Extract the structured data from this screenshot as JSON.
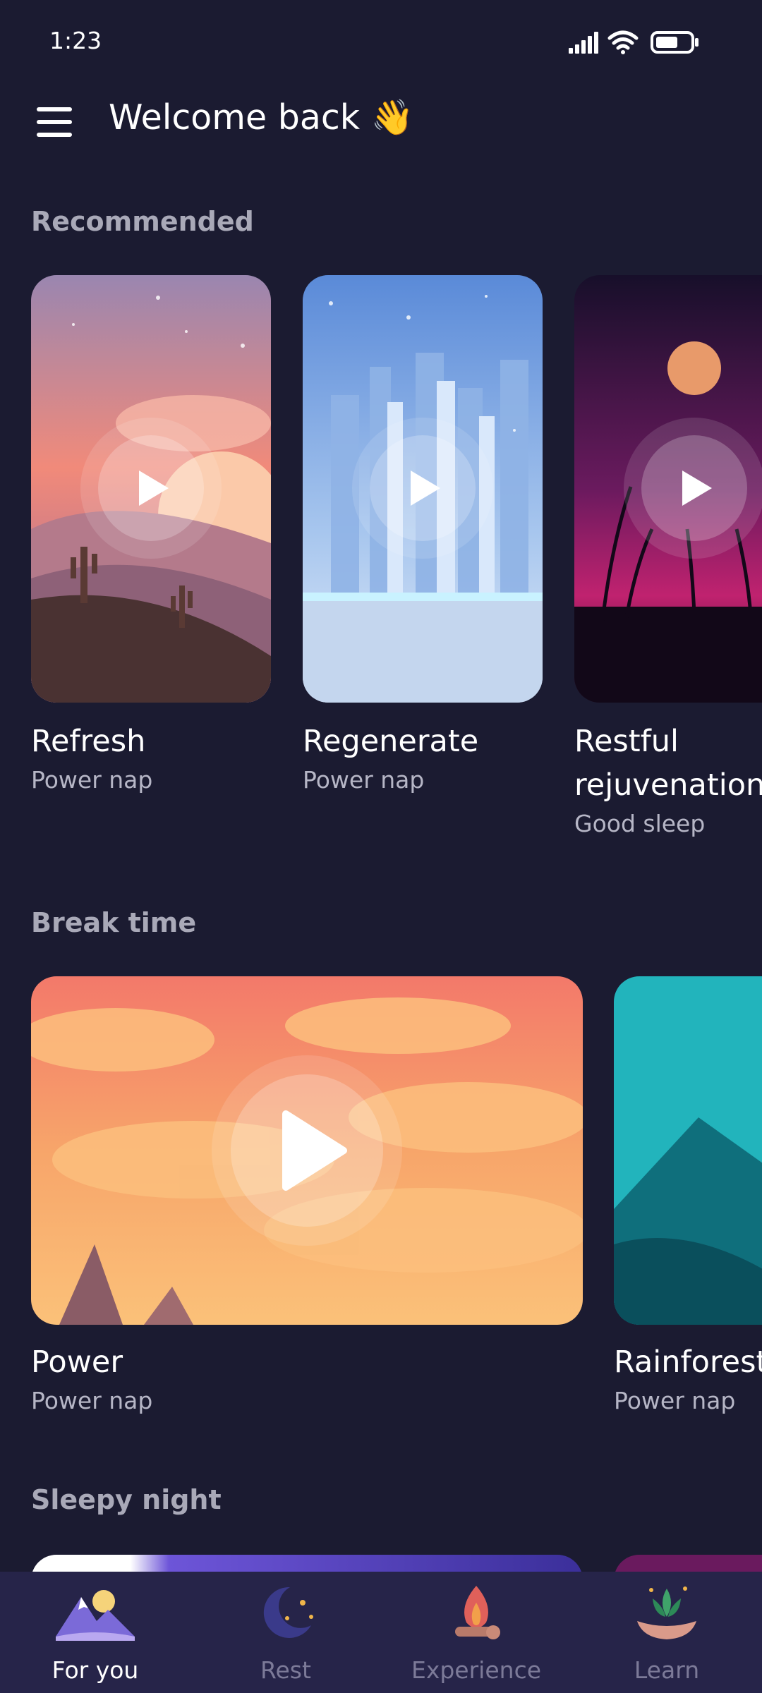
{
  "status_bar": {
    "time": "1:23"
  },
  "header": {
    "title": "Welcome back 👋"
  },
  "sections": {
    "recommended": {
      "title": "Recommended",
      "cards": [
        {
          "title": "Refresh",
          "subtitle": "Power nap"
        },
        {
          "title": "Regenerate",
          "subtitle": "Power nap"
        },
        {
          "title": "Restful rejuvenation",
          "subtitle": "Good sleep"
        }
      ]
    },
    "break_time": {
      "title": "Break time",
      "cards": [
        {
          "title": "Power",
          "subtitle": "Power nap"
        },
        {
          "title": "Rainforest",
          "subtitle": "Power nap"
        }
      ]
    },
    "sleepy_night": {
      "title": "Sleepy night"
    }
  },
  "nav": {
    "items": [
      {
        "label": "For you",
        "icon": "mountains-icon",
        "active": true
      },
      {
        "label": "Rest",
        "icon": "moon-stars-icon",
        "active": false
      },
      {
        "label": "Experience",
        "icon": "campfire-icon",
        "active": false
      },
      {
        "label": "Learn",
        "icon": "lotus-hand-icon",
        "active": false
      }
    ]
  },
  "colors": {
    "background": "#1b1b31",
    "nav_background": "#262449",
    "muted_text": "#b6b6c6"
  }
}
